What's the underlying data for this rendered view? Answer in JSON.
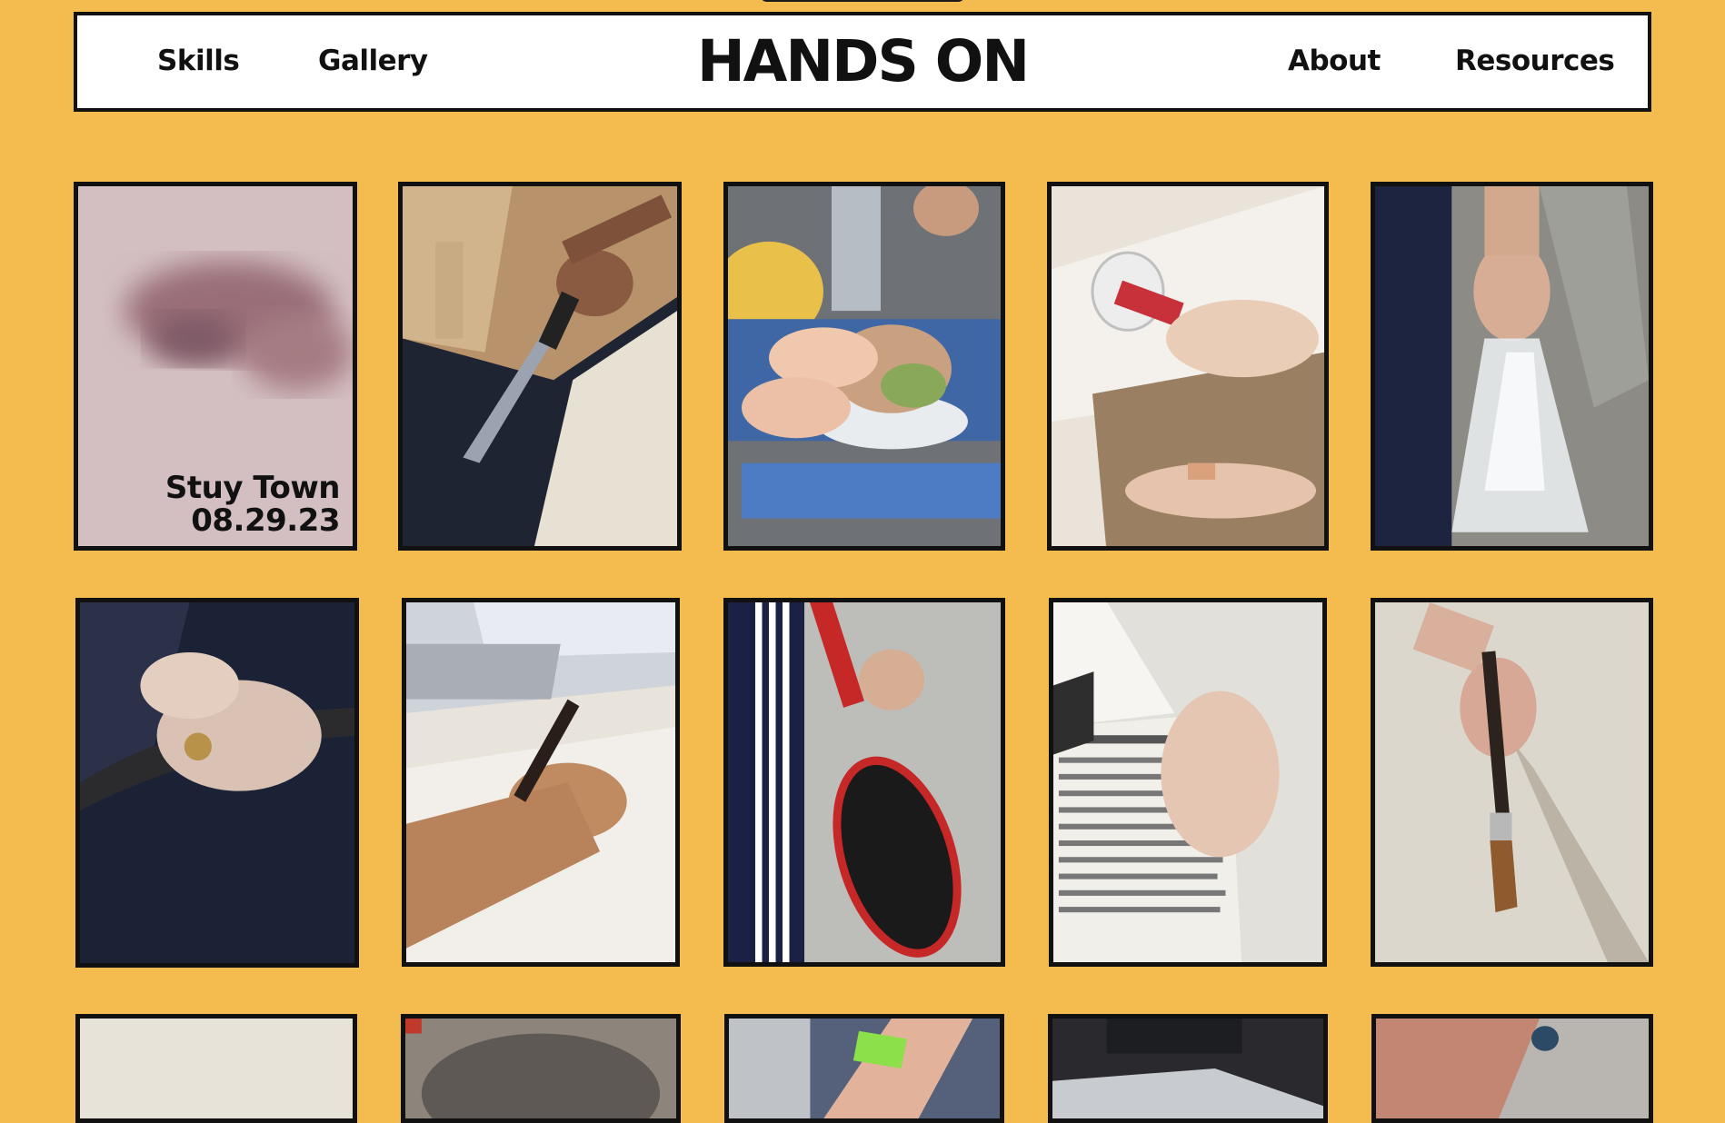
{
  "header": {
    "logo": "HANDS ON",
    "nav_left": [
      "Skills",
      "Gallery"
    ],
    "nav_right": [
      "About",
      "Resources"
    ]
  },
  "featured": {
    "location": "Stuy Town",
    "date": "08.29.23"
  },
  "gallery": {
    "tiles": [
      {
        "subject": "featured-blurred-hand"
      },
      {
        "subject": "hand-cutting-cardboard-box"
      },
      {
        "subject": "hands-holding-sandwich"
      },
      {
        "subject": "hands-taping-cardboard"
      },
      {
        "subject": "hand-carrying-plastic-bag"
      },
      {
        "subject": "hand-with-ring-gripping-cane"
      },
      {
        "subject": "hand-writing-in-notebook"
      },
      {
        "subject": "hand-holding-tennis-racket"
      },
      {
        "subject": "hand-holding-newspaper"
      },
      {
        "subject": "hand-holding-paintbrush"
      },
      {
        "subject": "photo-white-wall"
      },
      {
        "subject": "photo-sink-basin"
      },
      {
        "subject": "photo-wrist-green-band"
      },
      {
        "subject": "photo-plastic-wrap"
      },
      {
        "subject": "photo-tattooed-arm"
      }
    ]
  },
  "colors": {
    "background": "#F4BC4F",
    "navbar": "#FFFFFF",
    "border": "#111111"
  }
}
